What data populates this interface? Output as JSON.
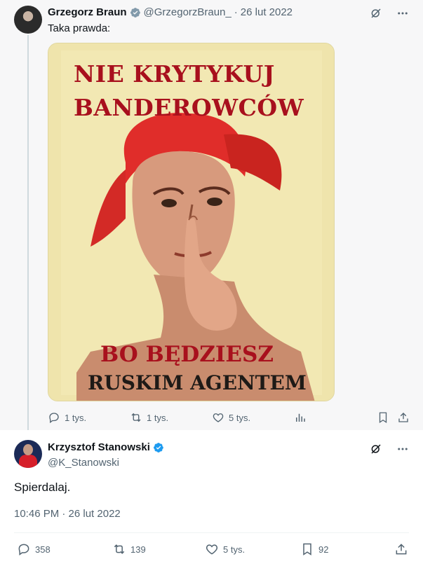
{
  "parent_tweet": {
    "author_name": "Grzegorz Braun",
    "handle": "@GrzegorzBraun_",
    "date": "26 lut 2022",
    "text": "Taka prawda:",
    "poster": {
      "line1": "NIE KRYTYKUJ",
      "line2": "BANDEROWCÓW",
      "line3": "BO BĘDZIESZ",
      "line4": "RUSKIM AGENTEM"
    },
    "stats": {
      "replies": "1 tys.",
      "reposts": "1 tys.",
      "likes": "5 tys."
    }
  },
  "main_tweet": {
    "author_name": "Krzysztof Stanowski",
    "handle": "@K_Stanowski",
    "text": "Spierdalaj.",
    "timestamp": "10:46 PM · 26 lut 2022",
    "stats": {
      "replies": "358",
      "reposts": "139",
      "likes": "5 tys.",
      "bookmarks": "92"
    }
  },
  "icons": {
    "verified": "verified-badge-icon",
    "grok": "grok-icon",
    "more": "more-options-icon",
    "reply": "reply-icon",
    "repost": "repost-icon",
    "like": "like-icon",
    "views": "views-icon",
    "bookmark": "bookmark-icon",
    "share": "share-icon"
  },
  "colors": {
    "verified_blue": "#1d9bf0",
    "poster_red": "#a8101d",
    "muted_text": "#536471"
  }
}
